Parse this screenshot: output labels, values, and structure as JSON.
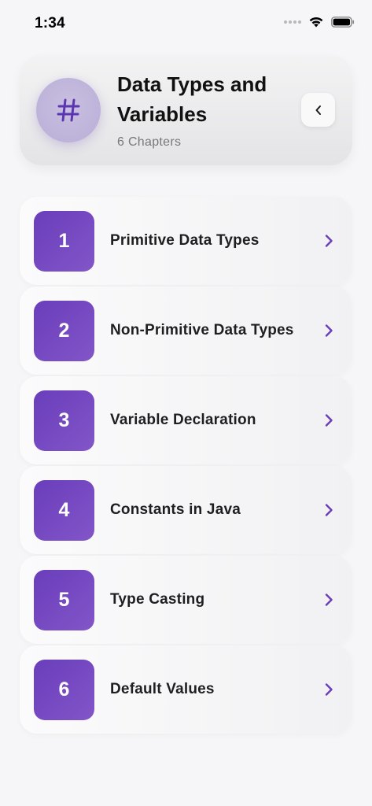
{
  "status_bar": {
    "time": "1:34"
  },
  "header": {
    "icon_glyph": "#",
    "title": "Data Types and Variables",
    "subtitle": "6 Chapters"
  },
  "chapters": [
    {
      "number": "1",
      "title": "Primitive Data Types"
    },
    {
      "number": "2",
      "title": "Non-Primitive Data Types"
    },
    {
      "number": "3",
      "title": "Variable Declaration"
    },
    {
      "number": "4",
      "title": "Constants in Java"
    },
    {
      "number": "5",
      "title": "Type Casting"
    },
    {
      "number": "6",
      "title": "Default Values"
    }
  ],
  "colors": {
    "accent": "#6a3dbb",
    "chevron": "#6a3dbb",
    "background": "#f6f6f8"
  },
  "icons": {
    "header": "hash-icon",
    "back": "chevron-left-icon",
    "row": "chevron-right-icon"
  }
}
